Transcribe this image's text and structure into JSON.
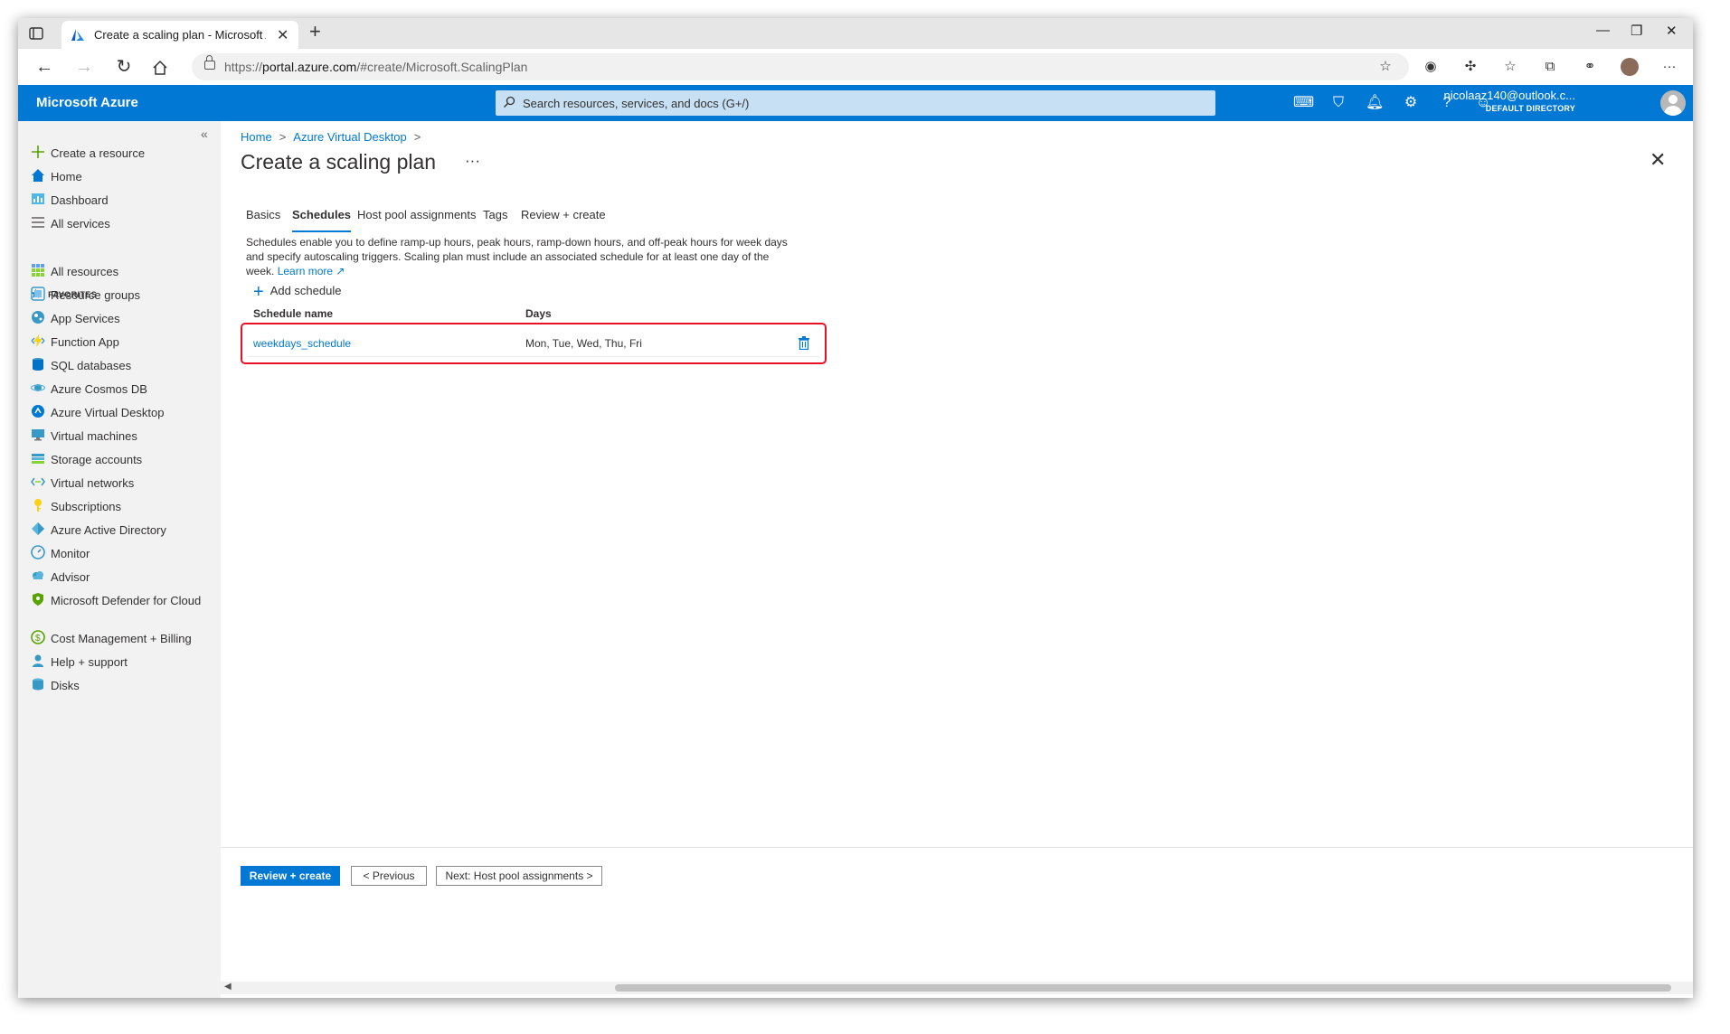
{
  "browser": {
    "tab_title": "Create a scaling plan - Microsoft Azure",
    "url_prefix": "https://",
    "url_host": "portal.azure.com",
    "url_path": "/#create/Microsoft.ScalingPlan"
  },
  "header": {
    "brand": "Microsoft Azure",
    "search_placeholder": "Search resources, services, and docs (G+/)",
    "user_email": "nicolaaz140@outlook.c...",
    "directory": "DEFAULT DIRECTORY"
  },
  "sidebar": {
    "favorites_label": "FAVORITES",
    "items": [
      {
        "label": "Create a resource",
        "icon": "plus-icon"
      },
      {
        "label": "Home",
        "icon": "home-icon"
      },
      {
        "label": "Dashboard",
        "icon": "dashboard-icon"
      },
      {
        "label": "All services",
        "icon": "list-icon"
      },
      {
        "label": "All resources",
        "icon": "grid-icon"
      },
      {
        "label": "Resource groups",
        "icon": "resource-group-icon"
      },
      {
        "label": "App Services",
        "icon": "globe-icon"
      },
      {
        "label": "Function App",
        "icon": "lightning-icon"
      },
      {
        "label": "SQL databases",
        "icon": "sql-icon"
      },
      {
        "label": "Azure Cosmos DB",
        "icon": "cosmos-icon"
      },
      {
        "label": "Azure Virtual Desktop",
        "icon": "virtual-desktop-icon"
      },
      {
        "label": "Virtual machines",
        "icon": "monitor-icon"
      },
      {
        "label": "Storage accounts",
        "icon": "storage-icon"
      },
      {
        "label": "Virtual networks",
        "icon": "network-icon"
      },
      {
        "label": "Subscriptions",
        "icon": "key-icon"
      },
      {
        "label": "Azure Active Directory",
        "icon": "diamond-icon"
      },
      {
        "label": "Monitor",
        "icon": "gauge-icon"
      },
      {
        "label": "Advisor",
        "icon": "cloud-icon"
      },
      {
        "label": "Microsoft Defender for Cloud",
        "icon": "shield-icon"
      },
      {
        "label": "Cost Management + Billing",
        "icon": "cost-icon"
      },
      {
        "label": "Help + support",
        "icon": "person-icon"
      },
      {
        "label": "Disks",
        "icon": "disk-icon"
      }
    ]
  },
  "breadcrumb": [
    "Home",
    "Azure Virtual Desktop"
  ],
  "page": {
    "title": "Create a scaling plan",
    "more": "···"
  },
  "tabs": [
    "Basics",
    "Schedules",
    "Host pool assignments",
    "Tags",
    "Review + create"
  ],
  "active_tab": "Schedules",
  "description": "Schedules enable you to define ramp-up hours, peak hours, ramp-down hours, and off-peak hours for week days and specify autoscaling triggers. Scaling plan must include an associated schedule for at least one day of the week.",
  "learn_more": "Learn more",
  "add_schedule": "Add schedule",
  "table": {
    "headers": [
      "Schedule name",
      "Days"
    ],
    "rows": [
      {
        "name": "weekdays_schedule",
        "days": "Mon, Tue, Wed, Thu, Fri"
      }
    ]
  },
  "footer": {
    "review_create": "Review + create",
    "previous": "< Previous",
    "next": "Next: Host pool assignments >"
  },
  "colors": {
    "azure_blue": "#0078d4",
    "highlight_red": "#e81123",
    "sidebar_bg": "#f2f2f2"
  }
}
